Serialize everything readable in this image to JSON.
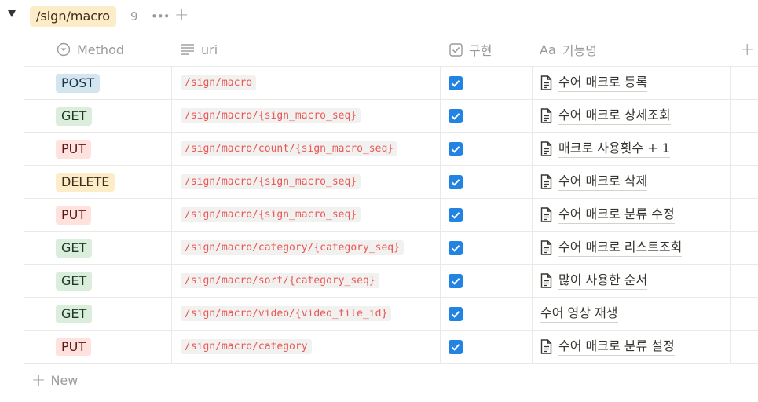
{
  "group": {
    "title": "/sign/macro",
    "count": "9",
    "more": "•••",
    "add": "+"
  },
  "columns": [
    {
      "label": "Method",
      "icon": "select-icon"
    },
    {
      "label": "uri",
      "icon": "text-lines-icon"
    },
    {
      "label": "구현",
      "icon": "checkbox-icon"
    },
    {
      "label": "기능명",
      "icon": "title-aa-icon",
      "icon_text": "Aa"
    }
  ],
  "add_column": "+",
  "colors": {
    "POST": {
      "bg": "#d3e5ef",
      "fg": "#183347"
    },
    "GET": {
      "bg": "#dbeddb",
      "fg": "#1c3829"
    },
    "PUT": {
      "bg": "#ffe2dd",
      "fg": "#5d1715"
    },
    "DELETE": {
      "bg": "#fdecc8",
      "fg": "#402c1b"
    },
    "checkbox": "#2383e2"
  },
  "rows": [
    {
      "method": "POST",
      "uri": "/sign/macro",
      "done": true,
      "name": "수어 매크로 등록",
      "doc": true
    },
    {
      "method": "GET",
      "uri": "/sign/macro/{sign_macro_seq}",
      "done": true,
      "name": "수어 매크로 상세조회",
      "doc": true
    },
    {
      "method": "PUT",
      "uri": "/sign/macro/count/{sign_macro_seq}",
      "done": true,
      "name": "매크로 사용횟수 + 1",
      "doc": true
    },
    {
      "method": "DELETE",
      "uri": "/sign/macro/{sign_macro_seq}",
      "done": true,
      "name": "수어 매크로 삭제",
      "doc": true
    },
    {
      "method": "PUT",
      "uri": "/sign/macro/{sign_macro_seq}",
      "done": true,
      "name": "수어 매크로 분류 수정",
      "doc": true
    },
    {
      "method": "GET",
      "uri": "/sign/macro/category/{category_seq}",
      "done": true,
      "name": "수어 매크로 리스트조회",
      "doc": true
    },
    {
      "method": "GET",
      "uri": "/sign/macro/sort/{category_seq}",
      "done": true,
      "name": "많이 사용한 순서",
      "doc": true
    },
    {
      "method": "GET",
      "uri": "/sign/macro/video/{video_file_id}",
      "done": true,
      "name": "수어 영상 재생",
      "doc": false
    },
    {
      "method": "PUT",
      "uri": "/sign/macro/category",
      "done": true,
      "name": "수어 매크로 분류 설정",
      "doc": true
    }
  ],
  "new_row": {
    "plus": "+",
    "label": "New"
  }
}
